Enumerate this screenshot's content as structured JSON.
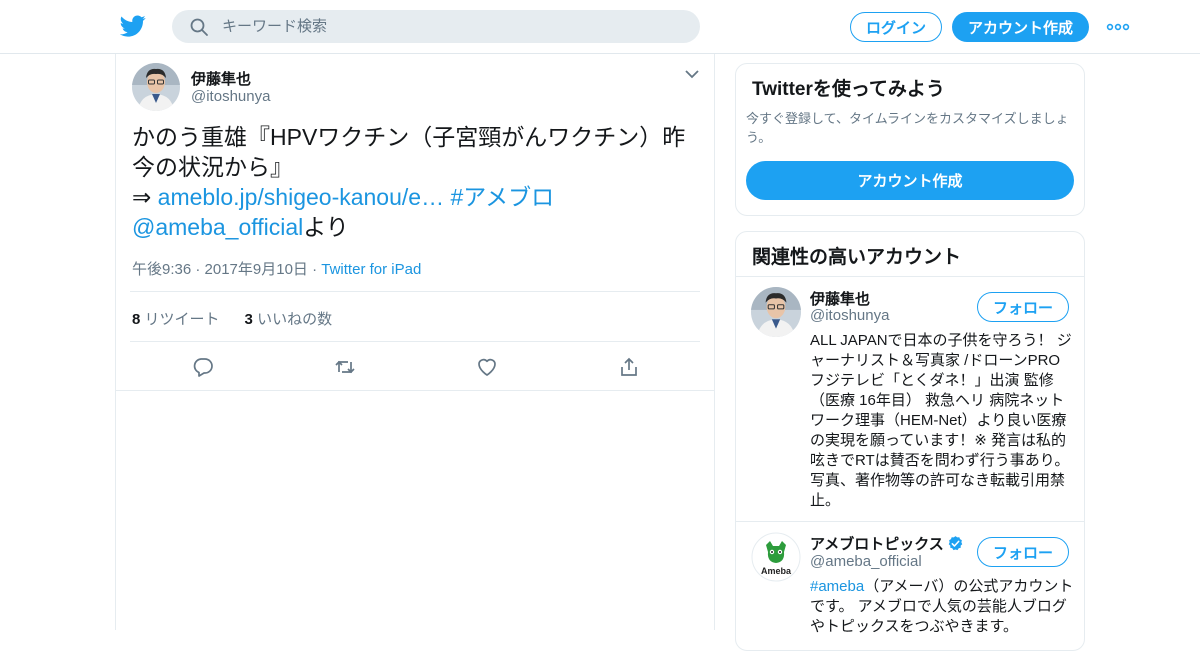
{
  "header": {
    "search_placeholder": "キーワード検索",
    "login_label": "ログイン",
    "signup_label": "アカウント作成"
  },
  "tweet": {
    "author_name": "伊藤隼也",
    "author_handle": "@itoshunya",
    "text_main": "かのう重雄『HPVワクチン（子宮頸がんワクチン）昨今の状況から』",
    "arrow": "⇒ ",
    "link": "ameblo.jp/shigeo-kanou/e…",
    "hashtag": "#アメブロ",
    "mention": "@ameba_official",
    "suffix": "より",
    "timestamp": "午後9:36 · 2017年9月10日",
    "separator": " · ",
    "source": "Twitter for iPad",
    "retweets_count": "8",
    "retweets_label": "リツイート",
    "likes_count": "3",
    "likes_label": "いいねの数"
  },
  "sidebar": {
    "try_twitter": {
      "title": "Twitterを使ってみよう",
      "subtitle": "今すぐ登録して、タイムラインをカスタマイズしましょう。",
      "button": "アカウント作成"
    },
    "related": {
      "title": "関連性の高いアカウント",
      "follow_label": "フォロー",
      "accounts": [
        {
          "name": "伊藤隼也",
          "handle": "@itoshunya",
          "bio": "ALL JAPANで日本の子供を守ろう！ ジャーナリスト＆写真家 /ドローンPRO フジテレビ「とくダネ！」出演 監修（医療 16年目） 救急ヘリ 病院ネットワーク理事（HEM-Net）より良い医療の実現を願っています！※ 発言は私的呟きでRTは賛否を問わず行う事あり。写真、著作物等の許可なき転載引用禁止。"
        },
        {
          "name": "アメブロトピックス",
          "handle": "@ameba_official",
          "bio_tag": "#ameba",
          "bio": "（アメーバ）の公式アカウントです。 アメブロで人気の芸能人ブログやトピックスをつぶやきます。",
          "avatar_text": "Ameba"
        }
      ]
    }
  },
  "colors": {
    "brand_blue": "#1da1f2",
    "link_blue": "#1b95e0",
    "muted_gray": "#657786"
  }
}
